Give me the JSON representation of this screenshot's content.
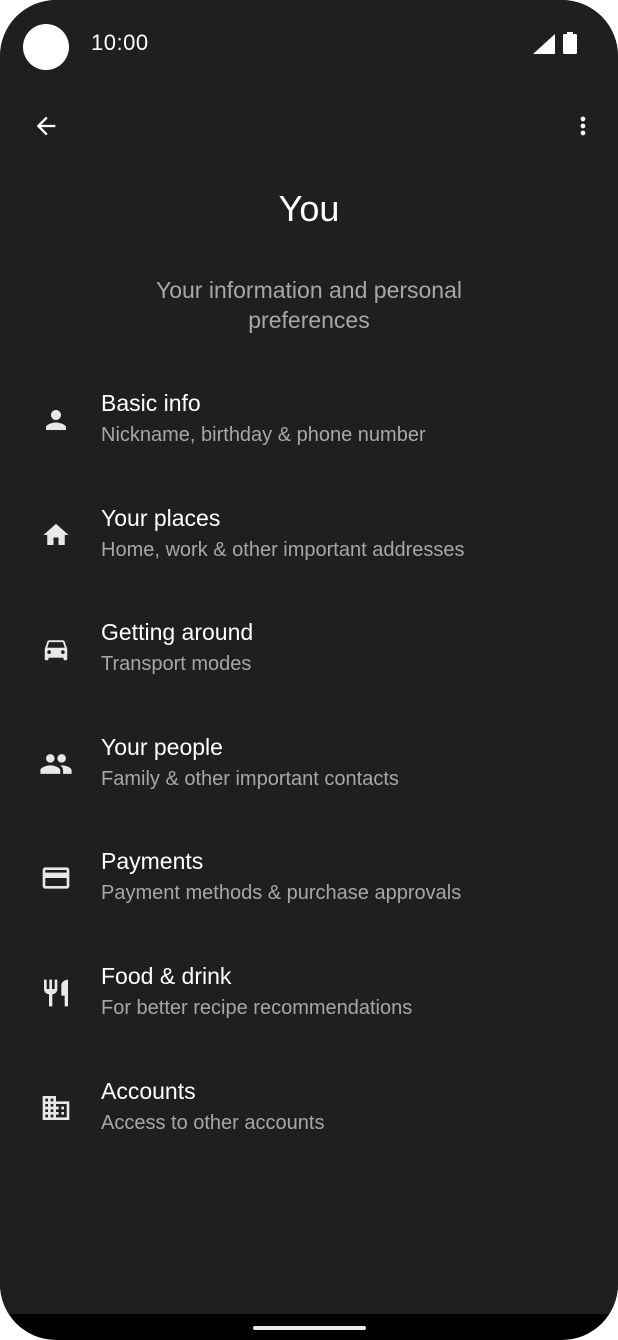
{
  "status_bar": {
    "time": "10:00",
    "icons": [
      "camera-cutout",
      "signal-icon",
      "battery-icon"
    ]
  },
  "toolbar": {
    "back_icon": "arrow-back-icon",
    "more_icon": "more-vert-icon"
  },
  "page": {
    "title": "You",
    "subtitle": "Your information and personal preferences"
  },
  "menu": {
    "items": [
      {
        "title": "Basic info",
        "description": "Nickname, birthday & phone number",
        "icon": "person-icon"
      },
      {
        "title": "Your places",
        "description": "Home, work & other important addresses",
        "icon": "home-icon"
      },
      {
        "title": "Getting around",
        "description": "Transport modes",
        "icon": "car-icon"
      },
      {
        "title": "Your people",
        "description": "Family & other important contacts",
        "icon": "people-icon"
      },
      {
        "title": "Payments",
        "description": "Payment methods & purchase approvals",
        "icon": "credit-card-icon"
      },
      {
        "title": "Food & drink",
        "description": "For better recipe recommendations",
        "icon": "restaurant-icon"
      },
      {
        "title": "Accounts",
        "description": "Access to other accounts",
        "icon": "business-icon"
      }
    ]
  },
  "colors": {
    "background": "#1f1f1f",
    "text_primary": "#ffffff",
    "text_secondary": "#a7a7a7",
    "icon": "#e8e8e8"
  }
}
